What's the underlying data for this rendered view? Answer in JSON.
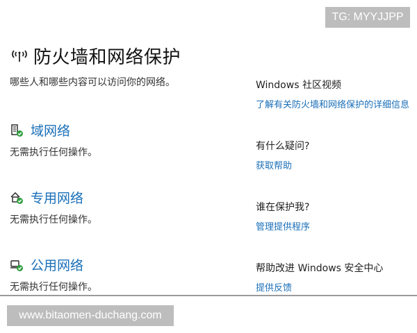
{
  "watermarks": {
    "top": "TG: MYYJJPP",
    "bottom": "www.bitaomen-duchang.com"
  },
  "header": {
    "icon": "firewall-wifi-icon",
    "title": "防火墙和网络保护"
  },
  "subtitle": "哪些人和哪些内容可以访问你的网络。",
  "networks": [
    {
      "icon": "domain-network-icon",
      "name": "域网络",
      "status": "无需执行任何操作。"
    },
    {
      "icon": "private-network-icon",
      "name": "专用网络",
      "status": "无需执行任何操作。"
    },
    {
      "icon": "public-network-icon",
      "name": "公用网络",
      "status": "无需执行任何操作。"
    }
  ],
  "sidebar": [
    {
      "heading": "Windows 社区视频",
      "link": "了解有关防火墙和网络保护的详细信息"
    },
    {
      "heading": "有什么疑问?",
      "link": "获取帮助"
    },
    {
      "heading": "谁在保护我?",
      "link": "管理提供程序"
    },
    {
      "heading": "帮助改进 Windows 安全中心",
      "link": "提供反馈"
    }
  ],
  "colors": {
    "link": "#1a6fb8",
    "check": "#2e9e3f",
    "watermark": "#bdbdbd"
  }
}
